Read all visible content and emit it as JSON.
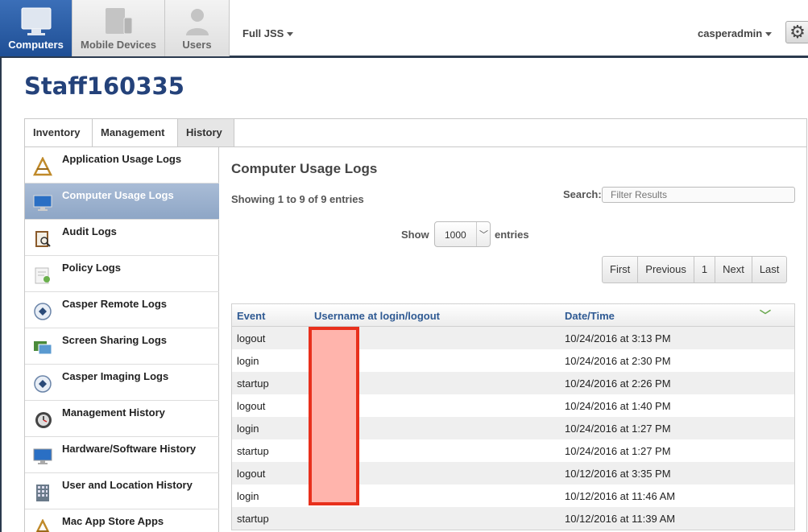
{
  "nav": {
    "tabs": [
      {
        "label": "Computers",
        "icon": "monitor-icon",
        "active": true
      },
      {
        "label": "Mobile Devices",
        "icon": "mobile-devices-icon",
        "active": false
      },
      {
        "label": "Users",
        "icon": "user-icon",
        "active": false
      }
    ],
    "site": "Full JSS",
    "user": "casperadmin",
    "settings_icon": "gear-icon"
  },
  "page": {
    "title": "Staff160335"
  },
  "tabs": [
    "Inventory",
    "Management",
    "History"
  ],
  "active_tab": "History",
  "sidebar": {
    "items": [
      {
        "label": "Application Usage Logs",
        "icon": "app-usage-icon"
      },
      {
        "label": "Computer Usage Logs",
        "icon": "computer-icon",
        "active": true
      },
      {
        "label": "Audit Logs",
        "icon": "audit-icon"
      },
      {
        "label": "Policy Logs",
        "icon": "policy-icon"
      },
      {
        "label": "Casper Remote Logs",
        "icon": "casper-remote-icon"
      },
      {
        "label": "Screen Sharing Logs",
        "icon": "screen-sharing-icon"
      },
      {
        "label": "Casper Imaging Logs",
        "icon": "casper-imaging-icon"
      },
      {
        "label": "Management History",
        "icon": "management-history-icon"
      },
      {
        "label": "Hardware/Software History",
        "icon": "hardware-software-icon"
      },
      {
        "label": "User and Location History",
        "icon": "building-icon"
      },
      {
        "label": "Mac App Store Apps",
        "icon": "app-store-icon"
      }
    ]
  },
  "main": {
    "title": "Computer Usage Logs",
    "showing": "Showing 1 to 9 of 9 entries",
    "search_label": "Search:",
    "search_placeholder": "Filter Results",
    "show_label": "Show",
    "show_value": "1000",
    "entries_label": "entries",
    "pager": [
      "First",
      "Previous",
      "1",
      "Next",
      "Last"
    ]
  },
  "table": {
    "columns": [
      "Event",
      "Username at login/logout",
      "Date/Time"
    ],
    "rows": [
      {
        "event": "logout",
        "datetime": "10/24/2016 at 3:13 PM"
      },
      {
        "event": "login",
        "datetime": "10/24/2016 at 2:30 PM"
      },
      {
        "event": "startup",
        "datetime": "10/24/2016 at 2:26 PM"
      },
      {
        "event": "logout",
        "datetime": "10/24/2016 at 1:40 PM"
      },
      {
        "event": "login",
        "datetime": "10/24/2016 at 1:27 PM"
      },
      {
        "event": "startup",
        "datetime": "10/24/2016 at 1:27 PM"
      },
      {
        "event": "logout",
        "datetime": "10/12/2016 at 3:35 PM"
      },
      {
        "event": "login",
        "datetime": "10/12/2016 at 11:46 AM"
      },
      {
        "event": "startup",
        "datetime": "10/12/2016 at 11:39 AM"
      }
    ]
  },
  "colors": {
    "accent": "#24427a",
    "nav_active": "#2a5da5",
    "redaction": "#ffb4ac",
    "redaction_border": "#e8301c"
  }
}
